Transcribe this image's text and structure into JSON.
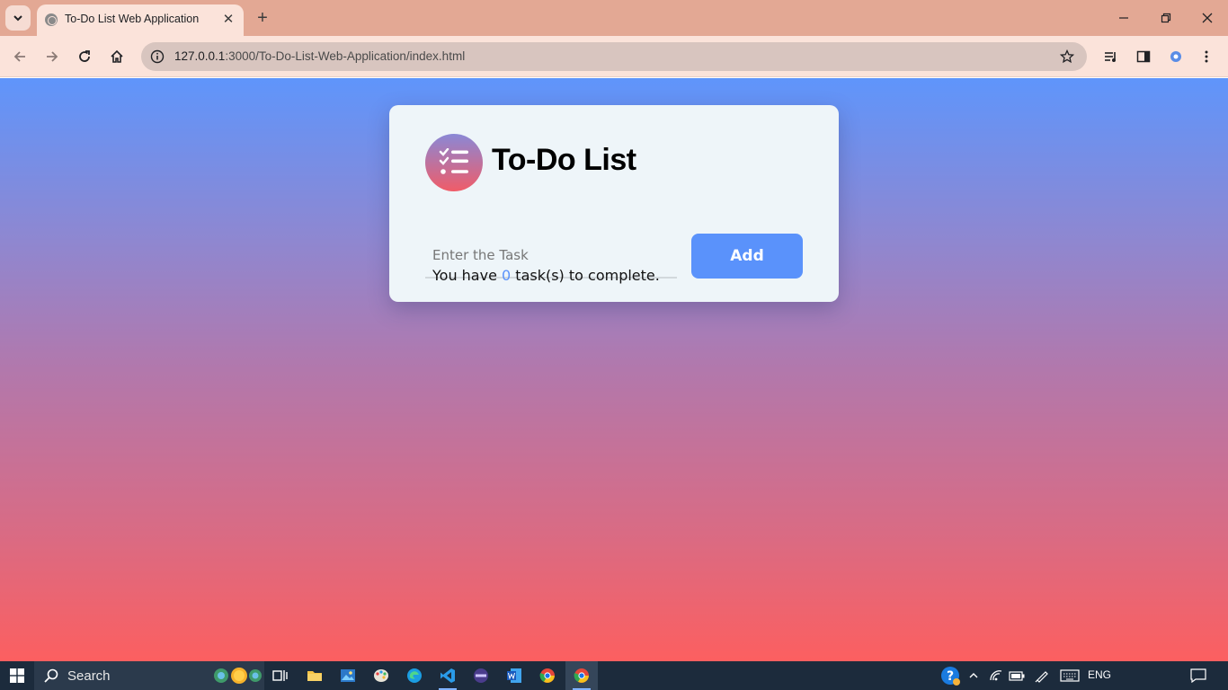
{
  "browser": {
    "tab_title": "To-Do List Web Application",
    "close_tab": "✕",
    "new_tab": "+",
    "url_host": "127.0.0.1",
    "url_rest": ":3000/To-Do-List-Web-Application/index.html"
  },
  "app": {
    "title": "To-Do List",
    "input_placeholder": "Enter the Task",
    "input_value": "",
    "add_label": "Add",
    "status_prefix": "You have ",
    "task_count": "0",
    "status_suffix": " task(s) to complete."
  },
  "taskbar": {
    "search_label": "Search",
    "language": "ENG"
  },
  "colors": {
    "accent": "#5a92fb",
    "gradient_top": "#5f95fb",
    "gradient_bottom": "#fc5f60",
    "card_bg": "#eef5f9"
  }
}
